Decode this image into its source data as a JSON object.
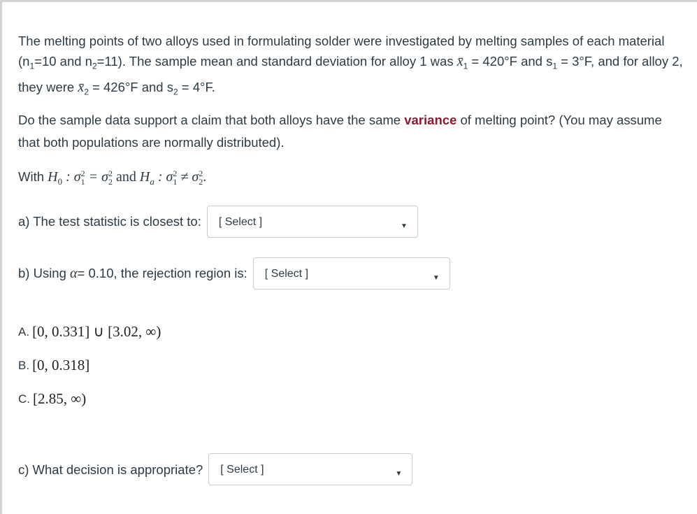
{
  "question": {
    "intro": {
      "text1": "The melting points of two alloys used in formulating solder were investigated by melting samples of each material (n",
      "n1_sub": "1",
      "text2": "=10 and n",
      "n2_sub": "2",
      "text3": "=11). The sample mean and standard deviation for alloy 1 was ",
      "xbar1": "x̄",
      "xbar1_sub": "1",
      "text4": " = 420°F and s",
      "s1_sub": "1",
      "text5": " = 3°F, and for alloy 2, they were ",
      "xbar2": "x̄",
      "xbar2_sub": "2",
      "text6": " = 426°F and s",
      "s2_sub": "2",
      "text7": " = 4°F."
    },
    "claim": {
      "before": "Do the sample data support a claim that both alloys have the same ",
      "highlight": "variance",
      "after": " of melting point? (You may assume that both populations are normally distributed)."
    },
    "hypotheses": {
      "with": "With ",
      "h0": "H",
      "h0_sub": "0",
      "h0_expr": " : σ",
      "h0_rhs": " = σ",
      "and": " and ",
      "ha": "H",
      "ha_sub": "a",
      "ha_expr": " : σ",
      "ha_rhs": " ≠ σ",
      "end": "."
    },
    "accent_color": "#8b1a2b"
  },
  "part_a": {
    "label": "a) The test statistic is closest to:",
    "select_value": "[ Select ]"
  },
  "part_b": {
    "label_pre": "b) Using ",
    "alpha": "α",
    "label_post": "= 0.10, the rejection region is:",
    "select_value": "[ Select ]"
  },
  "options": [
    {
      "letter": "A.",
      "expr": "[0, 0.331] ∪ [3.02, ∞)"
    },
    {
      "letter": "B.",
      "expr": "[0, 0.318]"
    },
    {
      "letter": "C.",
      "expr": "[2.85, ∞)"
    }
  ],
  "part_c": {
    "label": "c) What decision is appropriate?",
    "select_value": "[ Select ]"
  }
}
